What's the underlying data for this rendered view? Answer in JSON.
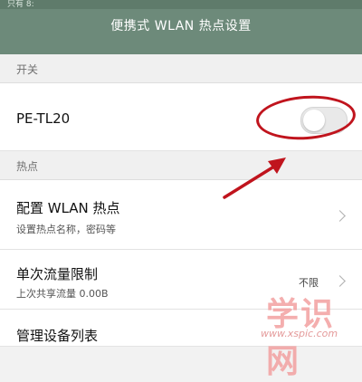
{
  "header": {
    "status_fragment": "只有 8:",
    "title": "便携式 WLAN 热点设置"
  },
  "sections": {
    "switch_label": "开关",
    "hotspot_label": "热点"
  },
  "switch_row": {
    "label": "PE-TL20",
    "toggle_on": false
  },
  "config_row": {
    "label": "配置 WLAN 热点",
    "sub": "设置热点名称，密码等"
  },
  "limit_row": {
    "label": "单次流量限制",
    "sub": "上次共享流量 0.00B",
    "value": "不限"
  },
  "devices_row": {
    "label": "管理设备列表"
  },
  "watermark": {
    "cn": "学识网",
    "url": "www.xspic.com"
  },
  "colors": {
    "header": "#6d8a7a",
    "annotation": "#c0141d"
  }
}
